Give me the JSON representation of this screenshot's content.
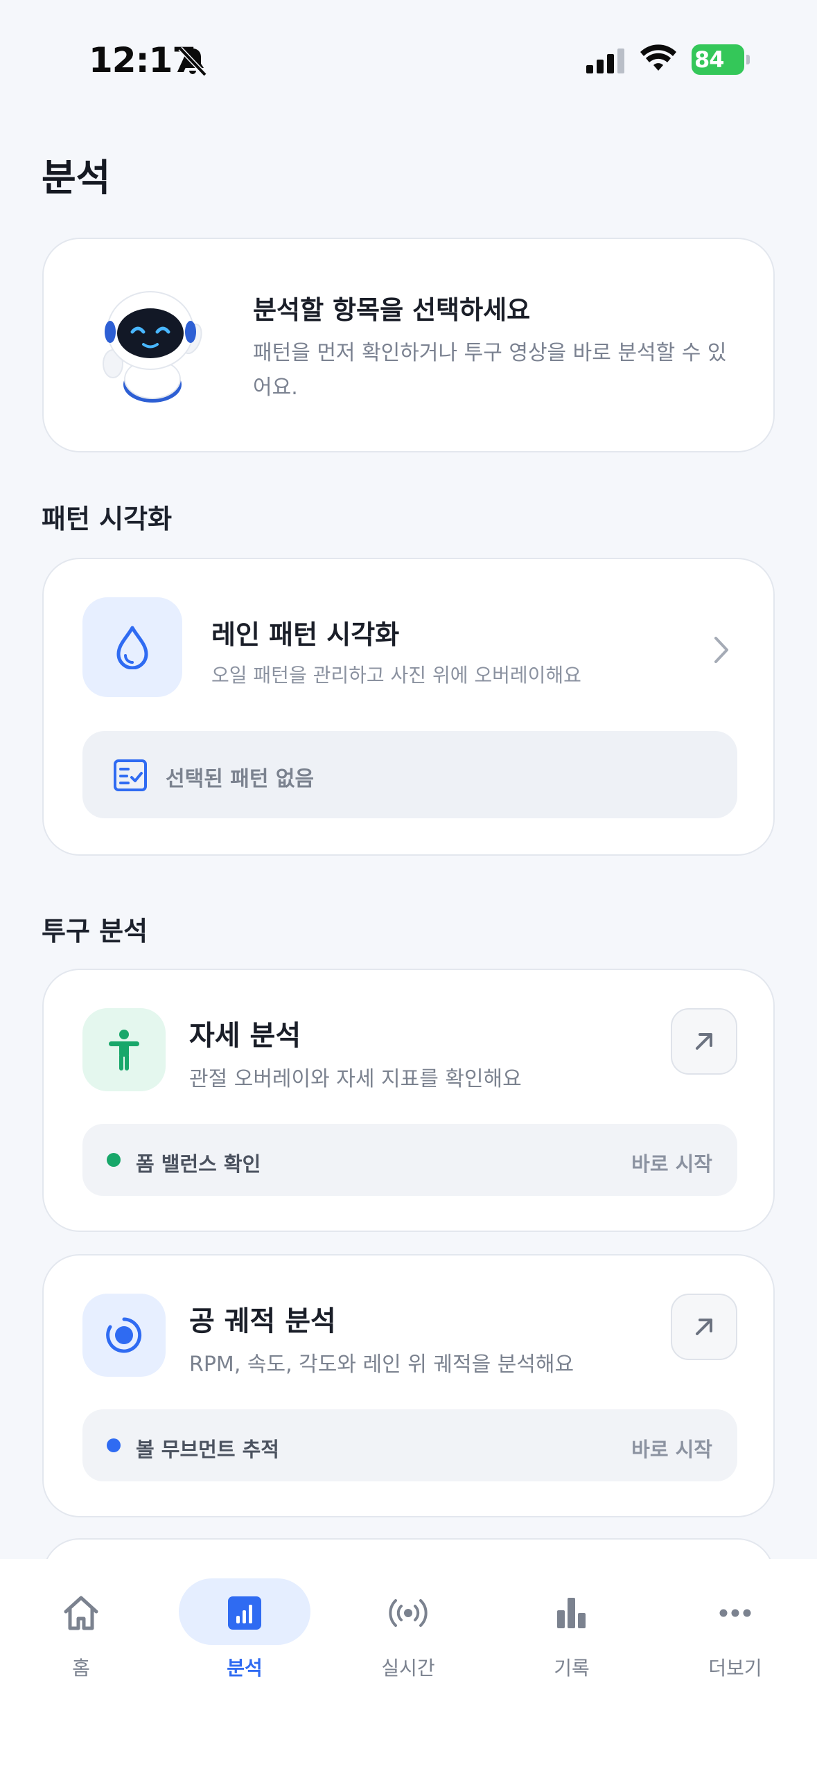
{
  "status_bar": {
    "time": "12:17",
    "battery": "84",
    "icons": [
      "bell-slash-icon",
      "cellular-signal-icon",
      "wifi-icon",
      "battery-charging-icon"
    ]
  },
  "page": {
    "title": "분석"
  },
  "intro_card": {
    "title": "분석할 항목을 선택하세요",
    "description": "패턴을 먼저 확인하거나 투구 영상을 바로 분석할 수 있어요.",
    "illustration": "robot-mascot"
  },
  "pattern_section": {
    "title": "패턴 시각화",
    "card": {
      "icon": "oil-drop-icon",
      "title": "레인 패턴 시각화",
      "description": "오일 패턴을 관리하고 사진 위에 오버레이해요",
      "selection_text": "선택된 패턴 없음"
    }
  },
  "pitch_section": {
    "title": "투구 분석",
    "cards": [
      {
        "icon": "person-figure-icon",
        "title": "자세 분석",
        "description": "관절 오버레이와 자세 지표를 확인해요",
        "tag": "폼 밸런스 확인",
        "action": "바로 시작"
      },
      {
        "icon": "target-icon",
        "title": "공 궤적 분석",
        "description": "RPM, 속도, 각도와 레인 위 궤적을 분석해요",
        "tag": "볼 무브먼트 추적",
        "action": "바로 시작"
      }
    ]
  },
  "tab_bar": {
    "active": "분석",
    "items": [
      {
        "label": "홈",
        "icon": "home-icon"
      },
      {
        "label": "분석",
        "icon": "chart-icon"
      },
      {
        "label": "실시간",
        "icon": "broadcast-icon"
      },
      {
        "label": "기록",
        "icon": "bar-chart-icon"
      },
      {
        "label": "더보기",
        "icon": "more-icon"
      }
    ]
  },
  "colors": {
    "accent": "#2f6bf2",
    "green": "#18a76a",
    "background": "#f5f7fb",
    "battery": "#34c759"
  }
}
